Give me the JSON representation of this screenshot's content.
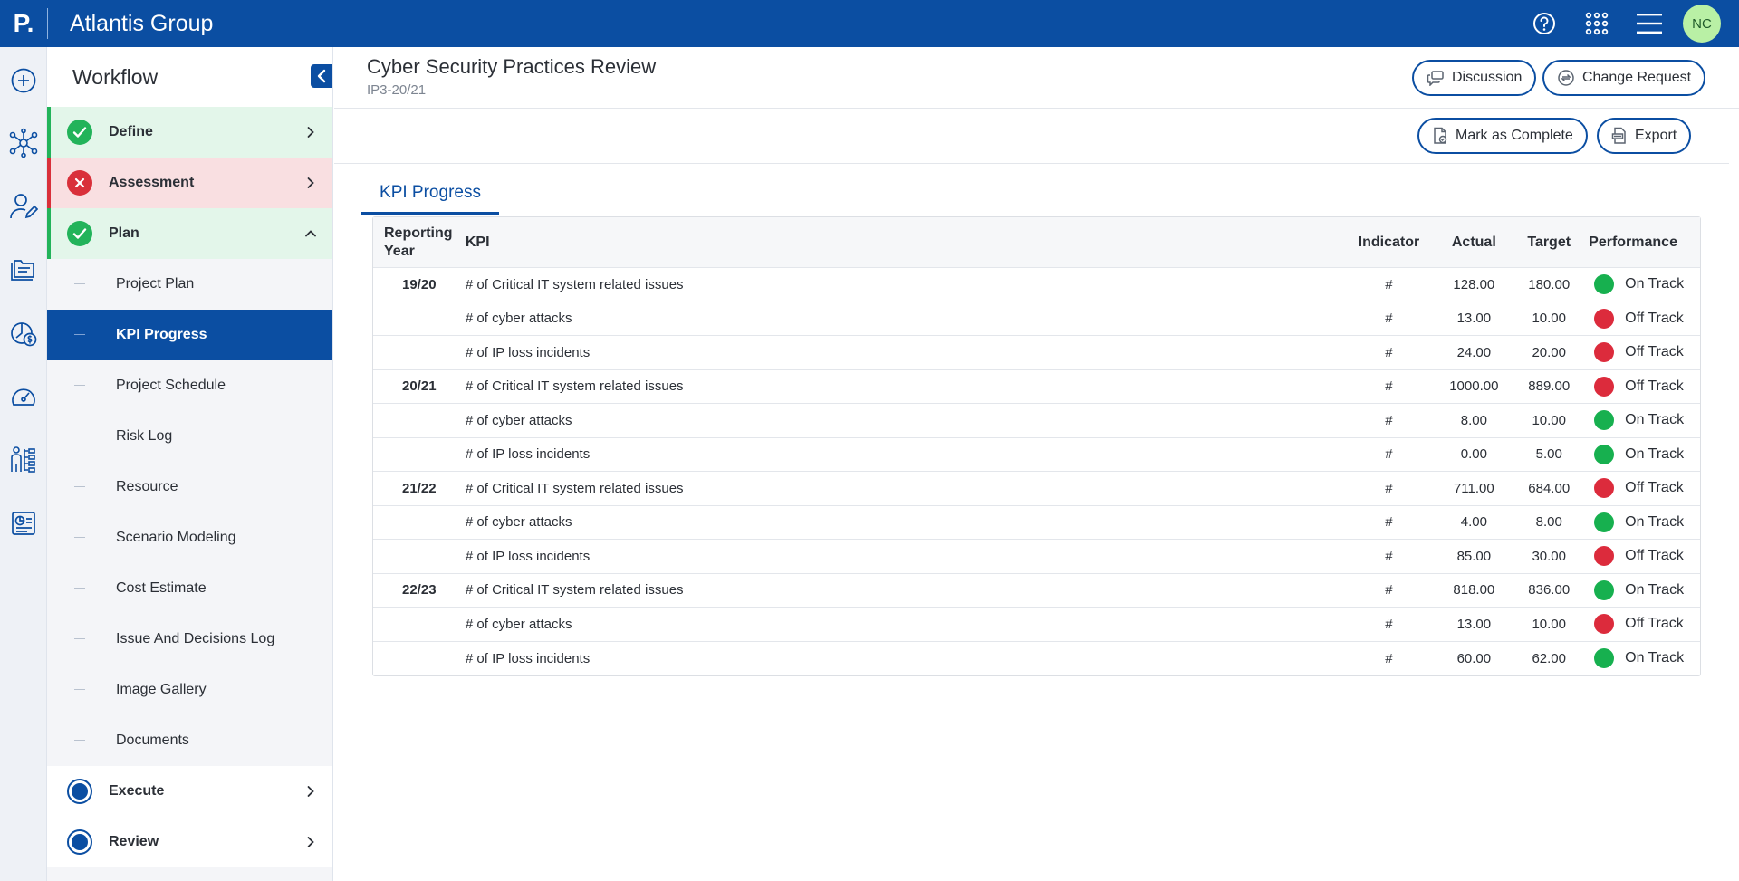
{
  "header": {
    "logo_letter": "P.",
    "app_name": "Atlantis Group",
    "avatar_initials": "NC",
    "icons": [
      "help-icon",
      "apps-grid-icon",
      "menu-icon"
    ],
    "brand_color": "#0b4ea2"
  },
  "rail": {
    "icons": [
      "add-icon",
      "network-icon",
      "user-edit-icon",
      "folders-icon",
      "budget-icon",
      "dashboard-icon",
      "org-chart-icon",
      "report-icon"
    ]
  },
  "workflow": {
    "title": "Workflow",
    "stages": [
      {
        "label": "Define",
        "status": "complete",
        "expanded": false
      },
      {
        "label": "Assessment",
        "status": "failed",
        "expanded": false
      },
      {
        "label": "Plan",
        "status": "complete",
        "expanded": true
      },
      {
        "label": "Execute",
        "status": "in-progress",
        "expanded": false
      },
      {
        "label": "Review",
        "status": "in-progress",
        "expanded": false
      }
    ],
    "plan_items": [
      {
        "label": "Project Plan",
        "active": false
      },
      {
        "label": "KPI Progress",
        "active": true
      },
      {
        "label": "Project Schedule",
        "active": false
      },
      {
        "label": "Risk Log",
        "active": false
      },
      {
        "label": "Resource",
        "active": false
      },
      {
        "label": "Scenario Modeling",
        "active": false
      },
      {
        "label": "Cost Estimate",
        "active": false
      },
      {
        "label": "Issue And Decisions Log",
        "active": false
      },
      {
        "label": "Image Gallery",
        "active": false
      },
      {
        "label": "Documents",
        "active": false
      }
    ]
  },
  "project": {
    "title": "Cyber Security Practices Review",
    "code": "IP3-20/21"
  },
  "actions": {
    "discussion": "Discussion",
    "change_request": "Change Request",
    "mark_complete": "Mark as Complete",
    "export": "Export"
  },
  "tab": {
    "label": "KPI Progress"
  },
  "table": {
    "columns": {
      "year_line1": "Reporting",
      "year_line2": "Year",
      "kpi": "KPI",
      "indicator": "Indicator",
      "actual": "Actual",
      "target": "Target",
      "performance": "Performance"
    },
    "rows": [
      {
        "year": "19/20",
        "kpi": "# of Critical IT system related issues",
        "indicator": "#",
        "actual": "128.00",
        "target": "180.00",
        "performance": "On Track",
        "status": "on"
      },
      {
        "year": "",
        "kpi": "# of cyber attacks",
        "indicator": "#",
        "actual": "13.00",
        "target": "10.00",
        "performance": "Off Track",
        "status": "off"
      },
      {
        "year": "",
        "kpi": "# of IP loss incidents",
        "indicator": "#",
        "actual": "24.00",
        "target": "20.00",
        "performance": "Off Track",
        "status": "off"
      },
      {
        "year": "20/21",
        "kpi": "# of Critical IT system related issues",
        "indicator": "#",
        "actual": "1000.00",
        "target": "889.00",
        "performance": "Off Track",
        "status": "off"
      },
      {
        "year": "",
        "kpi": "# of cyber attacks",
        "indicator": "#",
        "actual": "8.00",
        "target": "10.00",
        "performance": "On Track",
        "status": "on"
      },
      {
        "year": "",
        "kpi": "# of IP loss incidents",
        "indicator": "#",
        "actual": "0.00",
        "target": "5.00",
        "performance": "On Track",
        "status": "on"
      },
      {
        "year": "21/22",
        "kpi": "# of Critical IT system related issues",
        "indicator": "#",
        "actual": "711.00",
        "target": "684.00",
        "performance": "Off Track",
        "status": "off"
      },
      {
        "year": "",
        "kpi": "# of cyber attacks",
        "indicator": "#",
        "actual": "4.00",
        "target": "8.00",
        "performance": "On Track",
        "status": "on"
      },
      {
        "year": "",
        "kpi": "# of IP loss incidents",
        "indicator": "#",
        "actual": "85.00",
        "target": "30.00",
        "performance": "Off Track",
        "status": "off"
      },
      {
        "year": "22/23",
        "kpi": "# of Critical IT system related issues",
        "indicator": "#",
        "actual": "818.00",
        "target": "836.00",
        "performance": "On Track",
        "status": "on"
      },
      {
        "year": "",
        "kpi": "# of cyber attacks",
        "indicator": "#",
        "actual": "13.00",
        "target": "10.00",
        "performance": "Off Track",
        "status": "off"
      },
      {
        "year": "",
        "kpi": "# of IP loss incidents",
        "indicator": "#",
        "actual": "60.00",
        "target": "62.00",
        "performance": "On Track",
        "status": "on"
      }
    ]
  },
  "status_colors": {
    "on": "#17b04f",
    "off": "#dc2b3c",
    "complete": "#22b35a",
    "failed": "#d9303a",
    "in_progress": "#0b4ea2"
  }
}
